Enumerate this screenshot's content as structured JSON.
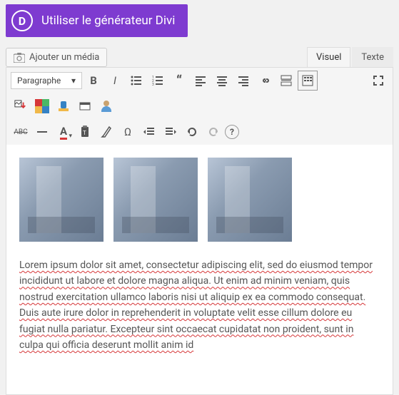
{
  "divi": {
    "label": "Utiliser le générateur Divi",
    "logo_letter": "D"
  },
  "media_button": {
    "label": "Ajouter un média"
  },
  "tabs": {
    "visual": "Visuel",
    "text": "Texte"
  },
  "format_dropdown": {
    "selected": "Paragraphe"
  },
  "toolbar_strikethrough": "ABC",
  "toolbar_textcolor": "A",
  "toolbar_omega": "Ω",
  "toolbar_help": "?",
  "content": {
    "paragraph": "Lorem ipsum dolor sit amet, consectetur adipiscing elit, sed do eiusmod tempor incididunt ut labore et dolore magna aliqua. Ut enim ad minim veniam, quis nostrud exercitation ullamco laboris nisi ut aliquip ex ea commodo consequat. Duis aute irure dolor in reprehenderit in voluptate velit esse cillum dolore eu fugiat nulla pariatur. Excepteur sint occaecat cupidatat non proident, sunt in culpa qui officia deserunt mollit anim id"
  }
}
